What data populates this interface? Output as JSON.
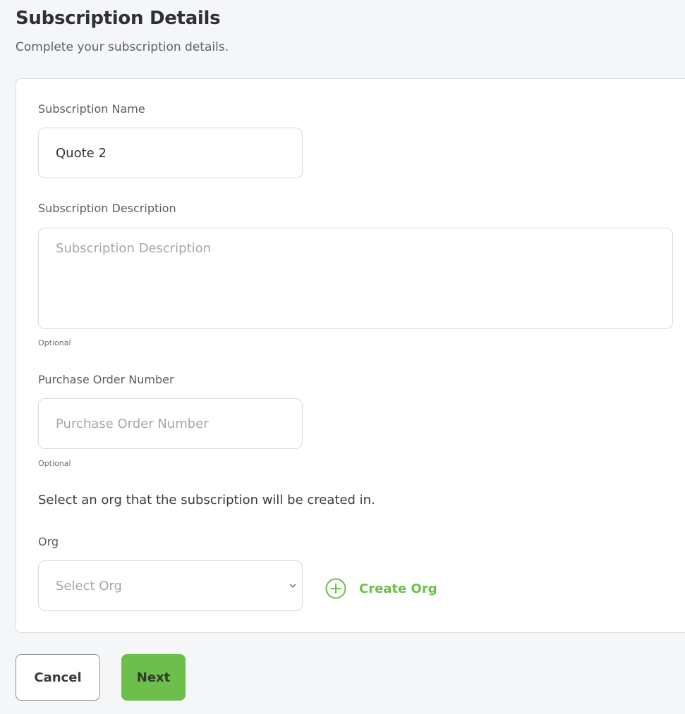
{
  "header": {
    "title": "Subscription Details",
    "subtitle": "Complete your subscription details."
  },
  "form": {
    "name": {
      "label": "Subscription Name",
      "value": "Quote 2"
    },
    "description": {
      "label": "Subscription Description",
      "placeholder": "Subscription Description",
      "hint": "Optional"
    },
    "po_number": {
      "label": "Purchase Order Number",
      "placeholder": "Purchase Order Number",
      "hint": "Optional"
    },
    "org_note": "Select an org that the subscription will be created in.",
    "org": {
      "label": "Org",
      "selected": "Select Org"
    },
    "create_org_label": "Create Org"
  },
  "actions": {
    "cancel_label": "Cancel",
    "next_label": "Next"
  },
  "colors": {
    "accent": "#6cbf4b",
    "background": "#f5f6f8",
    "card": "#ffffff"
  },
  "icons": {
    "create_org": "plus-circle-icon",
    "select": "chevron-down-icon"
  }
}
